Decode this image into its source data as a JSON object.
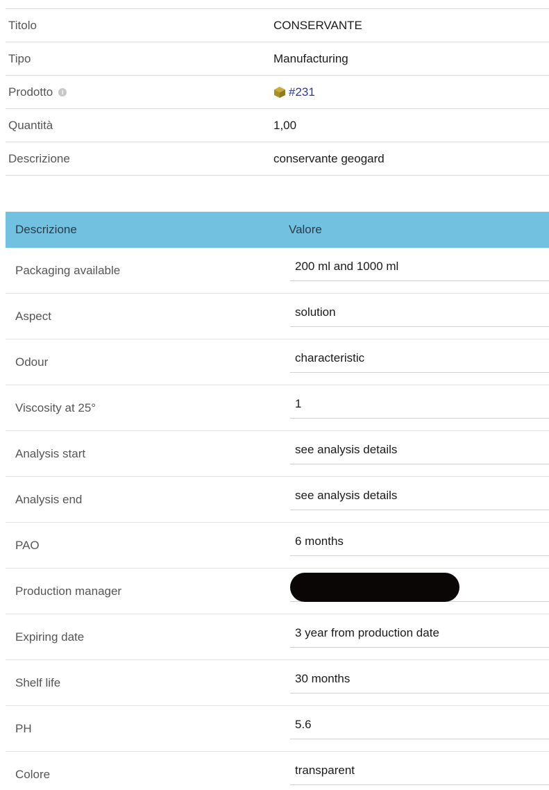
{
  "details": {
    "rows": [
      {
        "label": "Titolo",
        "value": "CONSERVANTE"
      },
      {
        "label": "Tipo",
        "value": "Manufacturing"
      },
      {
        "label": "Prodotto",
        "value": "#231"
      },
      {
        "label": "Quantità",
        "value": "1,00"
      },
      {
        "label": "Descrizione",
        "value": "conservante geogard"
      }
    ]
  },
  "attributes": {
    "headers": {
      "col1": "Descrizione",
      "col2": "Valore"
    },
    "rows": [
      {
        "label": "Packaging available",
        "value": "200 ml and 1000 ml"
      },
      {
        "label": "Aspect",
        "value": "solution"
      },
      {
        "label": "Odour",
        "value": "characteristic"
      },
      {
        "label": "Viscosity at 25°",
        "value": "1"
      },
      {
        "label": "Analysis start",
        "value": "see analysis details"
      },
      {
        "label": "Analysis end",
        "value": "see analysis details"
      },
      {
        "label": "PAO",
        "value": "6 months"
      },
      {
        "label": "Production manager",
        "value": ""
      },
      {
        "label": "Expiring date",
        "value": "3 year from production date"
      },
      {
        "label": "Shelf life",
        "value": "30 months"
      },
      {
        "label": "PH",
        "value": "5.6"
      },
      {
        "label": "Colore",
        "value": "transparent"
      }
    ]
  },
  "colors": {
    "header_bg": "#72c1e0",
    "link": "#2a3b8f",
    "product_icon": "#b59a2e"
  },
  "icons": {
    "info": "info-icon",
    "product": "cube-icon"
  }
}
